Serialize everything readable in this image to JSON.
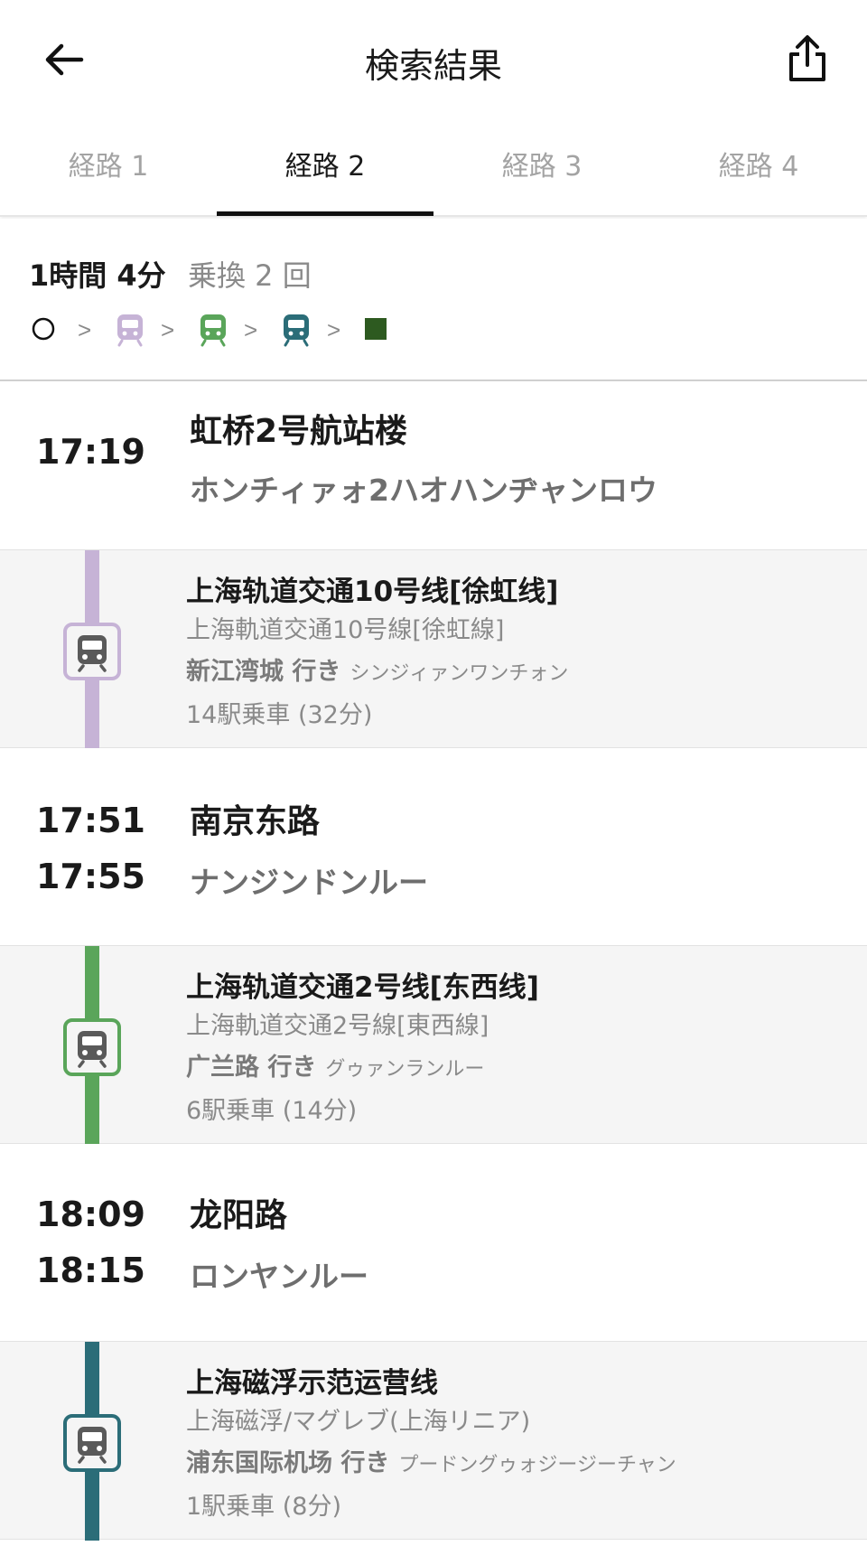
{
  "header": {
    "title": "検索結果"
  },
  "tabs": [
    {
      "label": "経路 1"
    },
    {
      "label": "経路 2"
    },
    {
      "label": "経路 3"
    },
    {
      "label": "経路 4"
    }
  ],
  "active_tab": 1,
  "summary": {
    "duration": "1時間 4分",
    "transfers": "乗換 2 回",
    "separator": ">"
  },
  "colors": {
    "line10": "#c6b3d6",
    "line2": "#5aa55a",
    "maglev": "#2b6d78",
    "destination": "#2d5a20"
  },
  "stations": [
    {
      "times": [
        "17:19"
      ],
      "name": "虹桥2号航站楼",
      "kana": "ホンチィァォ2ハオハンヂャンロウ"
    },
    {
      "times": [
        "17:51",
        "17:55"
      ],
      "name": "南京东路",
      "kana": "ナンジンドンルー"
    },
    {
      "times": [
        "18:09",
        "18:15"
      ],
      "name": "龙阳路",
      "kana": "ロンヤンルー"
    }
  ],
  "legs": [
    {
      "line": "上海轨道交通10号线[徐虹线]",
      "line_ja": "上海軌道交通10号線[徐虹線]",
      "direction": "新江湾城 行き",
      "direction_kana": "シンジィァンワンチォン",
      "stops": "14駅乗車 (32分)",
      "icon": "train-icon"
    },
    {
      "line": "上海轨道交通2号线[东西线]",
      "line_ja": "上海軌道交通2号線[東西線]",
      "direction": "广兰路 行き",
      "direction_kana": "グゥァンランルー",
      "stops": "6駅乗車 (14分)",
      "icon": "train-icon"
    },
    {
      "line": "上海磁浮示范运营线",
      "line_ja": "上海磁浮/マグレブ(上海リニア)",
      "direction": "浦东国际机场 行き",
      "direction_kana": "プードングゥォジージーチャン",
      "stops": "1駅乗車 (8分)",
      "icon": "train-icon"
    }
  ]
}
